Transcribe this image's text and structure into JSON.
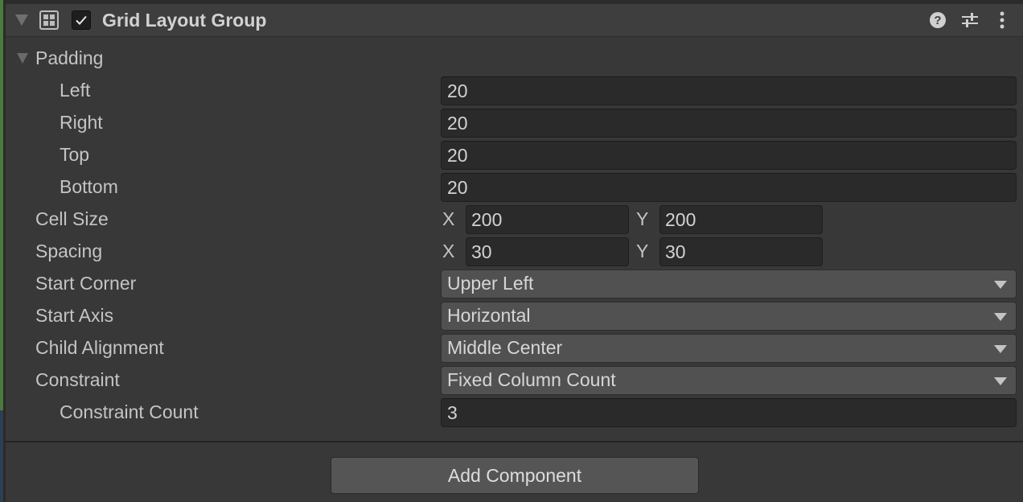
{
  "component": {
    "title": "Grid Layout Group",
    "enabled": true,
    "icons": [
      "grid-layout-icon",
      "help-icon",
      "presets-icon",
      "more-icon"
    ]
  },
  "padding": {
    "label": "Padding",
    "fields": [
      {
        "label": "Left",
        "value": "20"
      },
      {
        "label": "Right",
        "value": "20"
      },
      {
        "label": "Top",
        "value": "20"
      },
      {
        "label": "Bottom",
        "value": "20"
      }
    ]
  },
  "cell_size": {
    "label": "Cell Size",
    "x_label": "X",
    "x": "200",
    "y_label": "Y",
    "y": "200"
  },
  "spacing": {
    "label": "Spacing",
    "x_label": "X",
    "x": "30",
    "y_label": "Y",
    "y": "30"
  },
  "start_corner": {
    "label": "Start Corner",
    "value": "Upper Left"
  },
  "start_axis": {
    "label": "Start Axis",
    "value": "Horizontal"
  },
  "child_alignment": {
    "label": "Child Alignment",
    "value": "Middle Center"
  },
  "constraint": {
    "label": "Constraint",
    "value": "Fixed Column Count"
  },
  "constraint_count": {
    "label": "Constraint Count",
    "value": "3"
  },
  "add_component_label": "Add Component",
  "colors": {
    "background": "#383838",
    "field": "#2a2a2a",
    "dropdown": "#515151",
    "text": "#c4c4c4"
  }
}
